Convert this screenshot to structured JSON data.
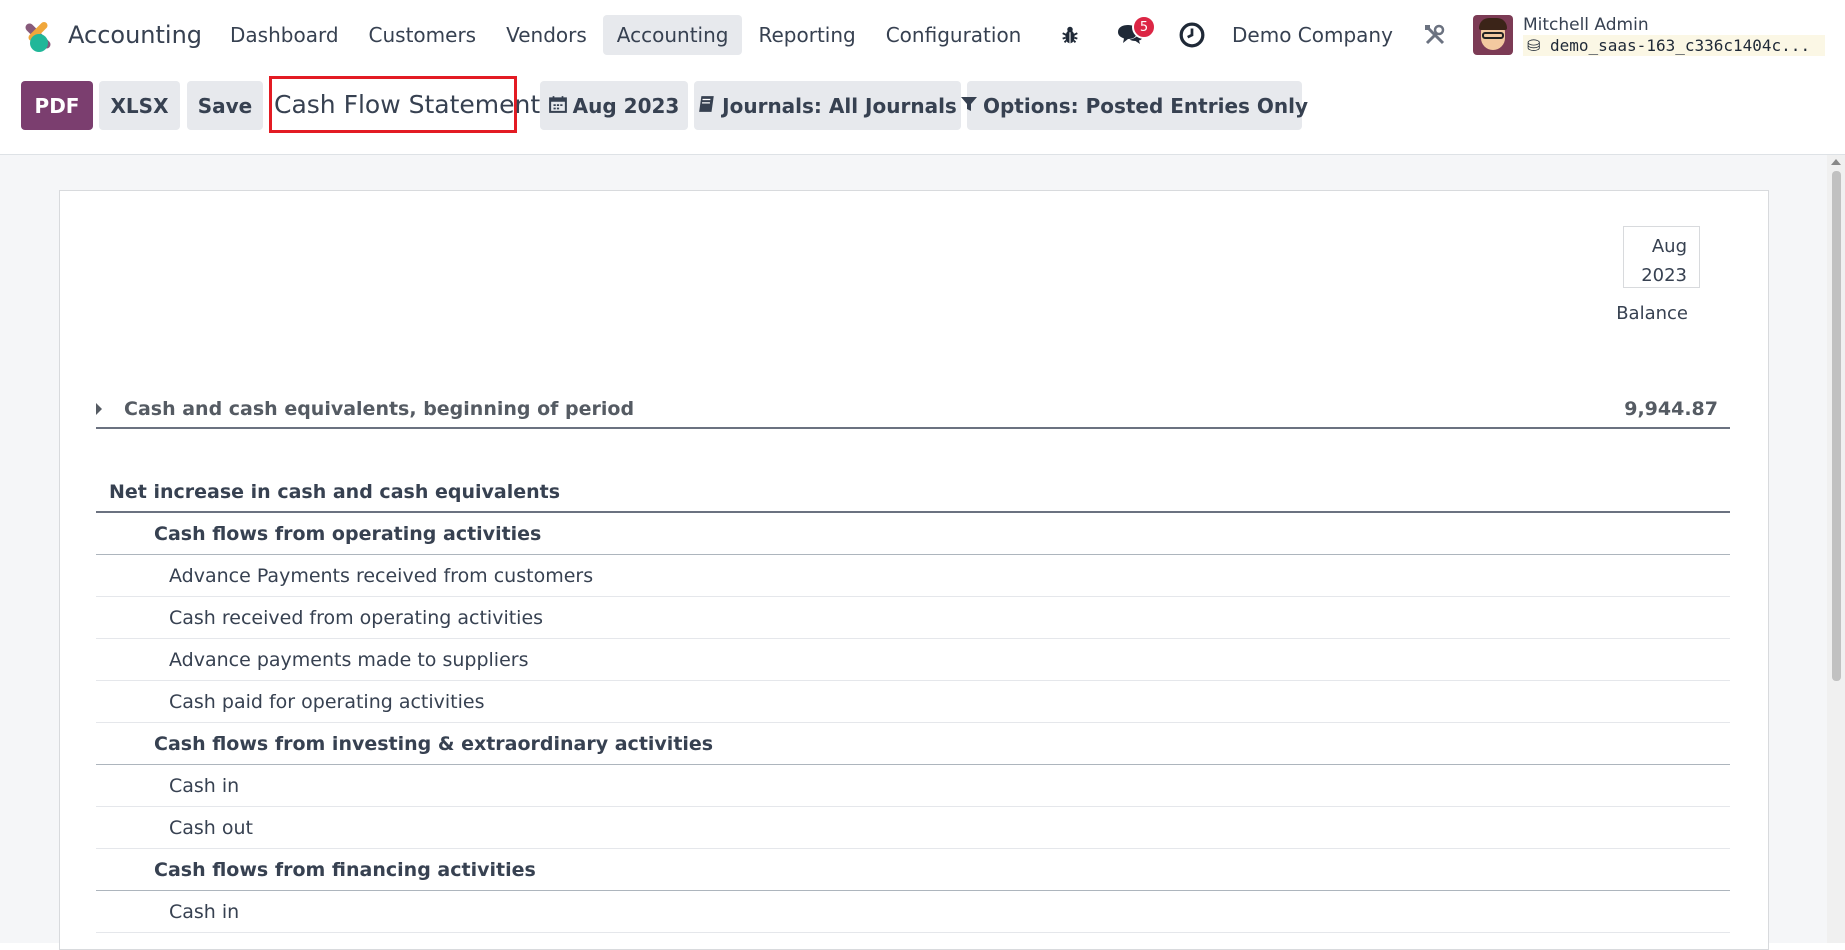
{
  "navbar": {
    "app_name": "Accounting",
    "menu": [
      "Dashboard",
      "Customers",
      "Vendors",
      "Accounting",
      "Reporting",
      "Configuration"
    ],
    "active_menu": "Accounting",
    "messages_count": "5",
    "company": "Demo Company",
    "user_name": "Mitchell Admin",
    "database": "demo_saas-163_c336c1404c..."
  },
  "controls": {
    "pdf": "PDF",
    "xlsx": "XLSX",
    "save": "Save",
    "report_title": "Cash Flow Statement",
    "date_filter": "Aug 2023",
    "journals_filter": "Journals: All Journals",
    "options_filter": "Options: Posted Entries Only"
  },
  "report": {
    "column_period_line1": "Aug",
    "column_period_line2": "2023",
    "column_balance": "Balance",
    "beginning": {
      "label": "Cash and cash equivalents, beginning of period",
      "value": "9,944.87"
    },
    "net_increase": "Net increase in cash and cash equivalents",
    "sections": [
      {
        "title": "Cash flows from operating activities",
        "lines": [
          "Advance Payments received from customers",
          "Cash received from operating activities",
          "Advance payments made to suppliers",
          "Cash paid for operating activities"
        ]
      },
      {
        "title": "Cash flows from investing & extraordinary activities",
        "lines": [
          "Cash in",
          "Cash out"
        ]
      },
      {
        "title": "Cash flows from financing activities",
        "lines": [
          "Cash in"
        ]
      }
    ]
  },
  "icons": {
    "debug": "bug-icon",
    "messages": "chat-icon",
    "activities": "clock-icon",
    "settings": "tools-icon",
    "database": "database-icon",
    "calendar": "calendar-icon",
    "journals": "book-icon",
    "options": "filter-icon"
  }
}
